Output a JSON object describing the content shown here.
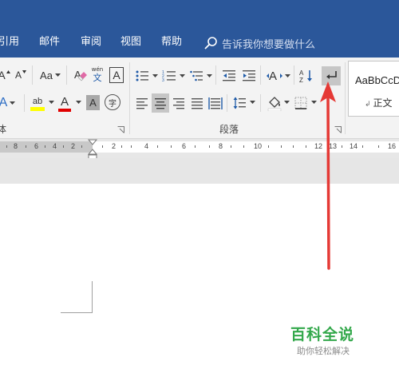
{
  "menu": {
    "items": [
      {
        "key": "references",
        "label": "引用"
      },
      {
        "key": "mailings",
        "label": "邮件"
      },
      {
        "key": "review",
        "label": "审阅"
      },
      {
        "key": "view",
        "label": "视图"
      },
      {
        "key": "help",
        "label": "帮助"
      }
    ],
    "tell_me": "告诉我你想要做什么",
    "bar_color": "#2b579a"
  },
  "ribbon": {
    "font_group": {
      "label_fragment": "体",
      "change_case_label": "Aa",
      "grow_font_glyph": "A",
      "shrink_font_glyph": "A",
      "phonetic_guide_top": "wén",
      "phonetic_guide_bottom": "文",
      "char_border_glyph": "A",
      "text_effects_glyph": "A",
      "highlight_label": "ab",
      "font_color_glyph": "A",
      "char_shading_glyph": "A",
      "enclose_char_glyph": "字",
      "highlight_color": "#ffff00",
      "font_color": "#e00000"
    },
    "paragraph_group": {
      "label": "段落",
      "show_marks_active": true
    },
    "styles_group": {
      "sample_text": "AaBbCcDd",
      "style_name": "正文",
      "style_mark": "↲"
    }
  },
  "ruler": {
    "left_numbers": [
      "8",
      "6",
      "4",
      "2"
    ],
    "right_numbers": [
      "2",
      "4",
      "6",
      "8",
      "10",
      "12",
      "13",
      "14",
      "16"
    ]
  },
  "watermark": {
    "title": "百科全说",
    "subtitle": "助你轻松解决",
    "title_color": "#33a84b"
  },
  "annotation": {
    "arrow_color": "#e53935"
  }
}
